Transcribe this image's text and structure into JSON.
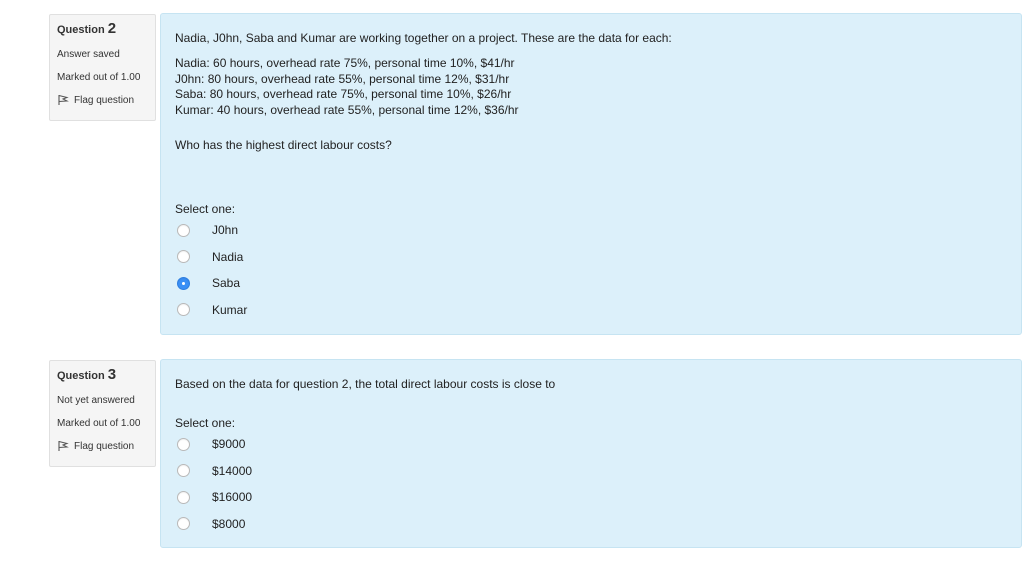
{
  "questions": [
    {
      "label": "Question",
      "number": "2",
      "state": "Answer saved",
      "grade": "Marked out of 1.00",
      "flag": "Flag question",
      "intro": "Nadia, J0hn, Saba and Kumar are working together on a project. These are the data for each:",
      "data_lines": [
        "Nadia: 60 hours, overhead rate 75%, personal time 10%, $41/hr",
        "J0hn: 80 hours, overhead rate 55%, personal time 12%, $31/hr",
        "Saba: 80 hours, overhead rate 75%, personal time 10%, $26/hr",
        "Kumar: 40 hours, overhead rate 55%, personal time 12%, $36/hr"
      ],
      "ask": "Who has the highest direct labour costs?",
      "prompt": "Select one:",
      "options": [
        "J0hn",
        "Nadia",
        "Saba",
        "Kumar"
      ],
      "selected": "Saba"
    },
    {
      "label": "Question",
      "number": "3",
      "state": "Not yet answered",
      "grade": "Marked out of 1.00",
      "flag": "Flag question",
      "text": "Based on the data for question 2, the total direct labour costs is close to",
      "prompt": "Select one:",
      "options": [
        "$9000",
        "$14000",
        "$16000",
        "$8000"
      ],
      "selected": null
    }
  ],
  "colors": {
    "content_bg": "#dcf0fa",
    "info_bg": "#f5f5f5",
    "radio_checked": "#3a8ff5"
  }
}
